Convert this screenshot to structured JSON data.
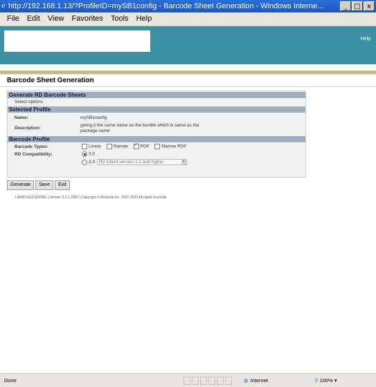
{
  "window": {
    "title": "http://192.168.1.13/?ProfileID=mySB1config - Barcode Sheet Generation - Windows Interne...",
    "buttons": {
      "minimize": "_",
      "maximize": "□",
      "close": "x"
    }
  },
  "menubar": {
    "items": [
      "File",
      "Edit",
      "View",
      "Favorites",
      "Tools",
      "Help"
    ]
  },
  "header": {
    "help_label": "Help"
  },
  "page": {
    "title": "Barcode Sheet Generation",
    "sections": {
      "generate": {
        "heading": "Generate RD Barcode Sheets",
        "instruction": "Select options"
      },
      "selected_profile": {
        "heading": "Selected Profile",
        "name_label": "Name:",
        "name_value": "mySB1config",
        "description_label": "Description:",
        "description_line1": "giving it the same name as the bundle which is same as the",
        "description_line2": "package name"
      },
      "barcode_profile": {
        "heading": "Barcode Profile",
        "types_label": "Barcode Types:",
        "types": [
          {
            "label": "Linear",
            "checked": false
          },
          {
            "label": "Narrow",
            "checked": false
          },
          {
            "label": "PDF",
            "checked": true
          },
          {
            "label": "Narrow PDF",
            "checked": false
          }
        ],
        "compat_label": "RD Compatibility:",
        "compat_options": [
          {
            "label": "3.0",
            "selected": true
          },
          {
            "label": "2.X",
            "selected": false
          }
        ],
        "compat_select_value": "RD Client version 1.1 and higher"
      }
    },
    "buttons": {
      "generate": "Generate",
      "save": "Save",
      "exit": "Exit"
    },
    "footer": "LARRY-K1CQKFI5E | Version 3.3.1.2000 | Copyright © Motorola Inc. 2007-2010 All rights reserved."
  },
  "statusbar": {
    "status": "Done",
    "zone": "Internet",
    "zoom": "100%"
  }
}
